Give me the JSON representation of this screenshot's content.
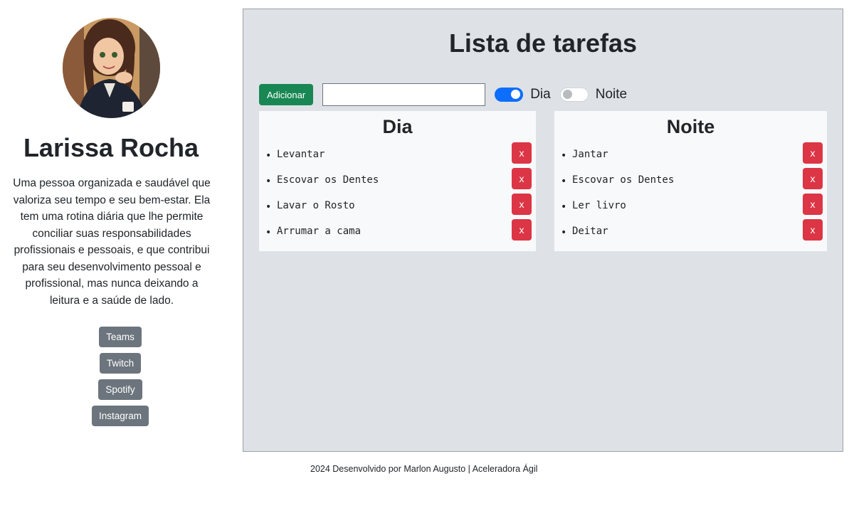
{
  "profile": {
    "name": "Larissa Rocha",
    "bio": "Uma pessoa organizada e saudável que valoriza seu tempo e seu bem-estar. Ela tem uma rotina diária que lhe permite conciliar suas responsabilidades profissionais e pessoais, e que contribui para seu desenvolvimento pessoal e profissional, mas nunca deixando a leitura e a saúde de lado.",
    "links": [
      {
        "label": "Teams"
      },
      {
        "label": "Twitch"
      },
      {
        "label": "Spotify"
      },
      {
        "label": "Instagram"
      }
    ]
  },
  "todo": {
    "title": "Lista de tarefas",
    "add_label": "Adicionar",
    "input_value": "",
    "switches": [
      {
        "label": "Dia",
        "checked": true
      },
      {
        "label": "Noite",
        "checked": false
      }
    ],
    "lists": [
      {
        "title": "Dia",
        "items": [
          "Levantar",
          "Escovar os Dentes",
          "Lavar o Rosto",
          "Arrumar a cama"
        ]
      },
      {
        "title": "Noite",
        "items": [
          "Jantar",
          "Escovar os Dentes",
          "Ler livro",
          "Deitar"
        ]
      }
    ],
    "delete_label": "x"
  },
  "footer": {
    "text": "2024 Desenvolvido por Marlon Augusto | Aceleradora Ágil"
  },
  "colors": {
    "add_button": "#198754",
    "delete_button": "#dc3545",
    "social_button": "#6c757d",
    "switch_on": "#0d6efd",
    "panel_bg": "#dee2e6",
    "card_bg": "#f8f9fa"
  }
}
